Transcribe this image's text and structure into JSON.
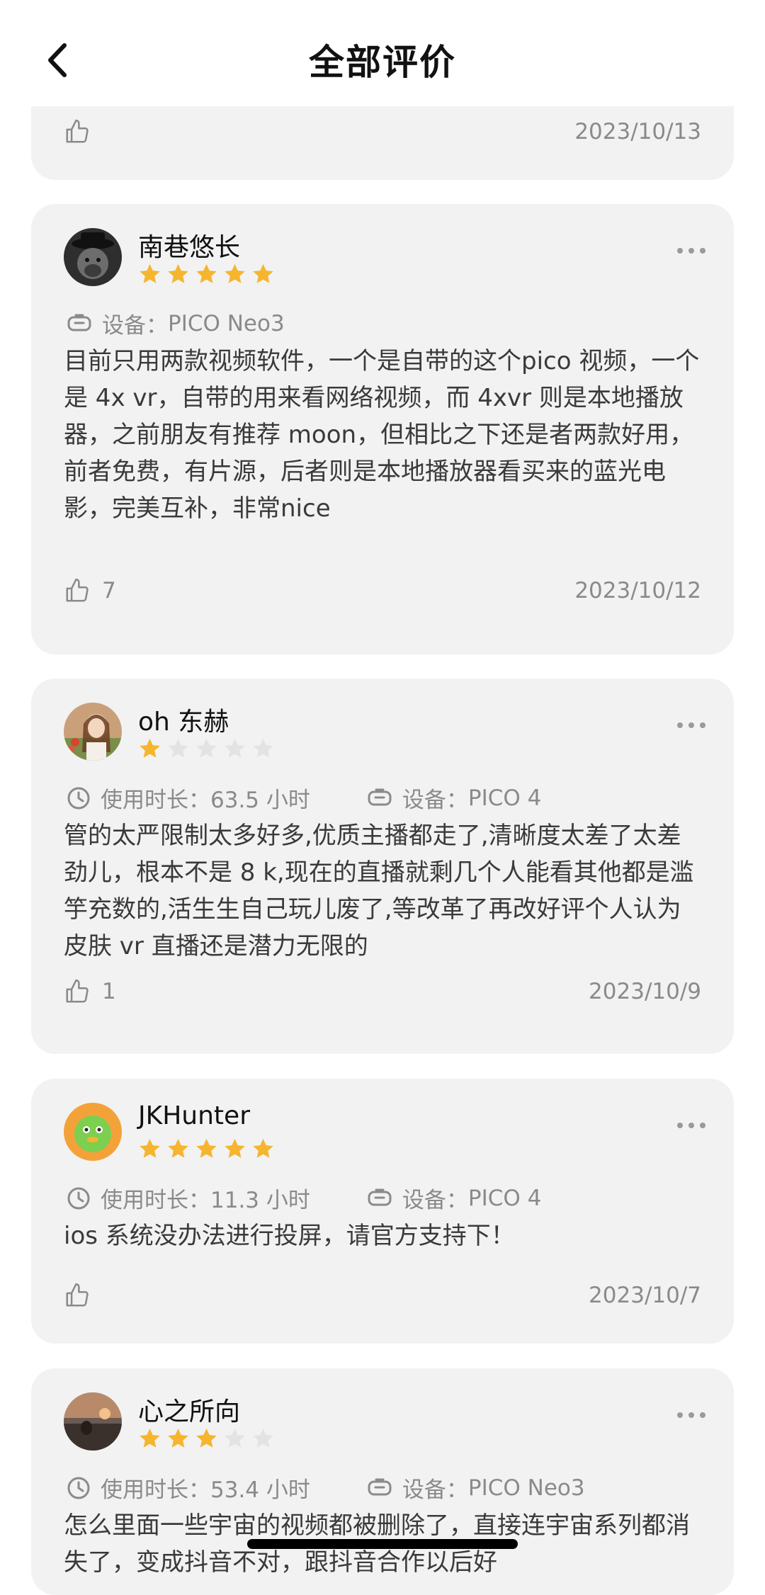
{
  "header": {
    "title": "全部评价"
  },
  "partial_card": {
    "date": "2023/10/13"
  },
  "reviews": [
    {
      "username": "南巷悠长",
      "rating": 5,
      "device_label": "设备：",
      "device": "PICO Neo3",
      "content": "目前只用两款视频软件，一个是自带的这个pico 视频，一个是 4x vr，自带的用来看网络视频，而 4xvr 则是本地播放器，之前朋友有推荐 moon，但相比之下还是者两款好用，前者免费，有片源，后者则是本地播放器看买来的蓝光电影，完美互补，非常nice",
      "likes": "7",
      "date": "2023/10/12"
    },
    {
      "username": "oh 东赫",
      "rating": 1,
      "duration_label": "使用时长：",
      "duration": "63.5 小时",
      "device_label": "设备：",
      "device": "PICO 4",
      "content": "管的太严限制太多好多,优质主播都走了,清晰度太差了太差劲儿，根本不是 8 k,现在的直播就剩几个人能看其他都是滥竽充数的,活生生自己玩儿废了,等改革了再改好评个人认为皮肤 vr 直播还是潜力无限的",
      "likes": "1",
      "date": "2023/10/9"
    },
    {
      "username": "JKHunter",
      "rating": 5,
      "duration_label": "使用时长：",
      "duration": "11.3 小时",
      "device_label": "设备：",
      "device": "PICO 4",
      "content": "ios 系统没办法进行投屏，请官方支持下！",
      "date": "2023/10/7"
    },
    {
      "username": "心之所向",
      "rating": 3,
      "duration_label": "使用时长：",
      "duration": "53.4 小时",
      "device_label": "设备：",
      "device": "PICO Neo3",
      "content": "怎么里面一些宇宙的视频都被删除了，直接连宇宙系列都消失了，变成抖音不对，跟抖音合作以后好"
    }
  ],
  "colors": {
    "star_filled": "#f5b52e",
    "star_empty": "#e3e3e3",
    "card_bg": "#f2f2f2"
  },
  "icons": [
    "back-chevron-icon",
    "thumbs-up-icon",
    "headset-icon",
    "clock-icon",
    "more-dots-icon",
    "star-icon"
  ]
}
